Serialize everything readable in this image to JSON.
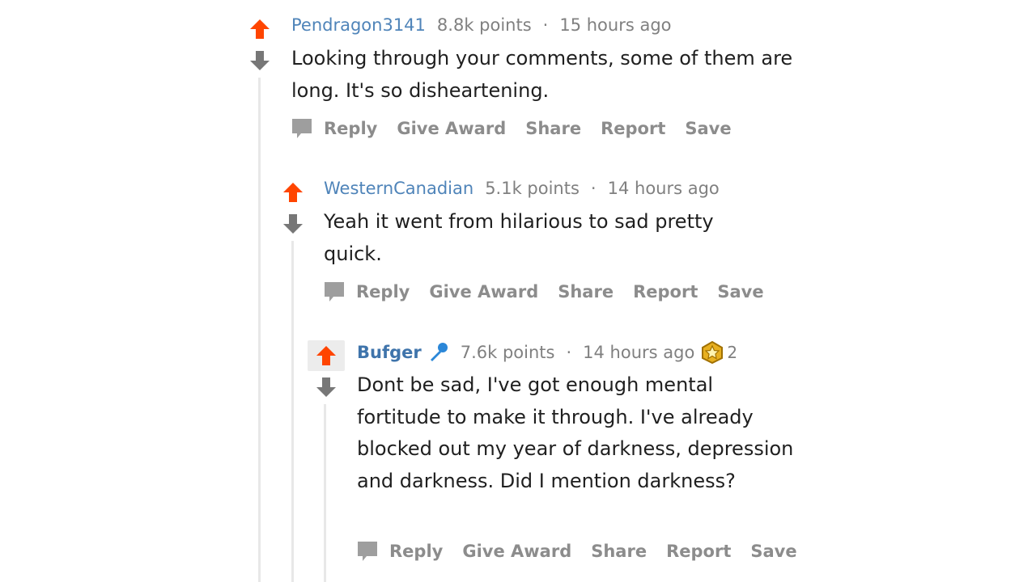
{
  "colors": {
    "upvote": "#ff4500",
    "downvote": "#777777",
    "link": "#4f84b9",
    "muted": "#8c8c8c"
  },
  "comments": [
    {
      "author": "Pendragon3141",
      "points": "8.8k points",
      "separator": "·",
      "time": "15 hours ago",
      "body": "Looking through your comments, some of them are long. It's so disheartening.",
      "actions": [
        "Reply",
        "Give Award",
        "Share",
        "Report",
        "Save"
      ]
    },
    {
      "author": "WesternCanadian",
      "points": "5.1k points",
      "separator": "·",
      "time": "14 hours ago",
      "body": "Yeah it went from hilarious to sad pretty quick.",
      "actions": [
        "Reply",
        "Give Award",
        "Share",
        "Report",
        "Save"
      ]
    },
    {
      "author": "Bufger",
      "author_icon": "microphone-icon",
      "points": "7.6k points",
      "separator": "·",
      "time": "14 hours ago",
      "award_icon": "gold-award-icon",
      "award_count": "2",
      "body": "Dont be sad, I've got enough mental fortitude to make it through. I've already blocked out my year of darkness, depression and darkness. Did I mention darkness?",
      "actions": [
        "Reply",
        "Give Award",
        "Share",
        "Report",
        "Save"
      ]
    }
  ]
}
